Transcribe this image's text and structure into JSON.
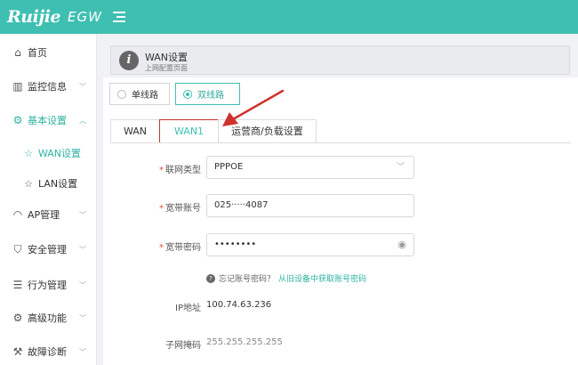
{
  "brand": {
    "logo": "Ruijie",
    "product": "EGW"
  },
  "sidebar": {
    "items": [
      {
        "label": "首页",
        "icon": "home-icon",
        "glyph": "⌂"
      },
      {
        "label": "监控信息",
        "icon": "monitor-icon",
        "glyph": "▥"
      },
      {
        "label": "基本设置",
        "icon": "gear-icon",
        "glyph": "⚙"
      },
      {
        "label": "WAN设置",
        "icon": "star-icon",
        "glyph": "☆"
      },
      {
        "label": "LAN设置",
        "icon": "star-icon",
        "glyph": "☆"
      },
      {
        "label": "AP管理",
        "icon": "wifi-icon",
        "glyph": "◠"
      },
      {
        "label": "安全管理",
        "icon": "shield-icon",
        "glyph": "⛉"
      },
      {
        "label": "行为管理",
        "icon": "sliders-icon",
        "glyph": "☰"
      },
      {
        "label": "高级功能",
        "icon": "settings-icon",
        "glyph": "⚙"
      },
      {
        "label": "故障诊断",
        "icon": "wrench-icon",
        "glyph": "⚒"
      }
    ]
  },
  "header": {
    "title": "WAN设置",
    "subtitle": "上网配置页面"
  },
  "mode": {
    "single": "单线路",
    "dual": "双线路",
    "selected": "dual"
  },
  "tabs": [
    "WAN",
    "WAN1",
    "运营商/负载设置"
  ],
  "active_tab": "WAN1",
  "form": {
    "conn_type_label": "联网类型",
    "conn_type_value": "PPPOE",
    "account_label": "宽带账号",
    "account_value": "025·····4087",
    "password_label": "宽带密码",
    "password_value": "••••••••",
    "hint_text": "忘记账号密码？",
    "hint_link": "从旧设备中获取账号密码",
    "ip_label": "IP地址",
    "ip_value": "100.74.63.236",
    "mask_label": "子网掩码",
    "mask_value": "255.255.255.255"
  },
  "colors": {
    "brand": "#3fbfb2",
    "active_tab_border": "#c0392b",
    "arrow": "#d0312d"
  }
}
